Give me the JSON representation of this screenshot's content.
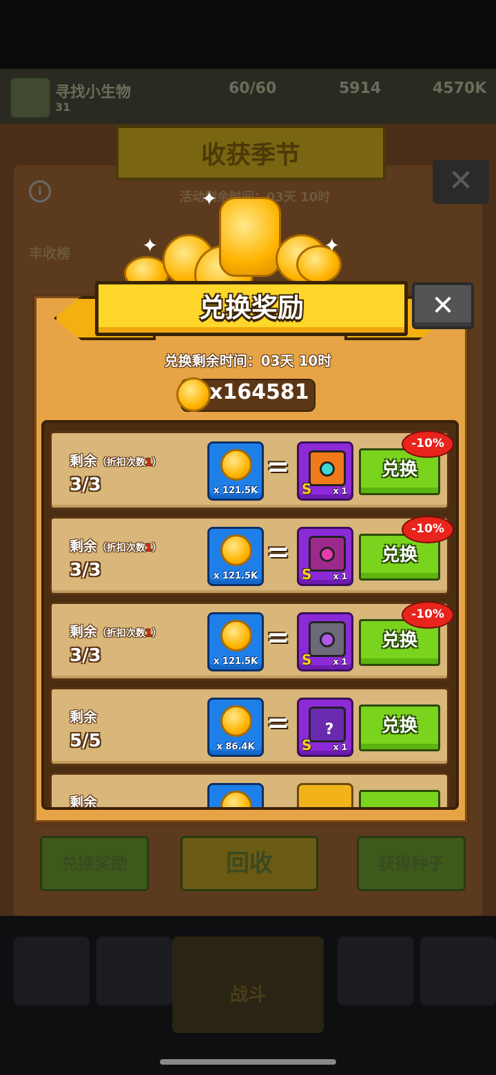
{
  "background": {
    "status_name": "寻找小生物",
    "status_level": "31",
    "energy": "60/60",
    "currency_1": "5914",
    "currency_2": "4570K",
    "season_title": "收获季节",
    "timer_text": "活动剩余时间：03天 10时",
    "rank_label": "丰收榜",
    "buttons": [
      "兑换奖励",
      "回收",
      "获得种子"
    ],
    "nav_center": "战斗"
  },
  "dialog": {
    "title": "兑换奖励",
    "close_label": "✕",
    "timer": "兑换剩余时间：03天 10时",
    "balance": "x164581"
  },
  "rows": [
    {
      "label": "剩余",
      "sub": "（折扣次数",
      "sub_count": "1",
      "sub_end": "）",
      "count": "3/3",
      "cost": "x 121.5K",
      "reward_grade": "S",
      "reward_qty": "x 1",
      "button": "兑换",
      "badge": "-10%"
    },
    {
      "label": "剩余",
      "sub": "（折扣次数",
      "sub_count": "1",
      "sub_end": "）",
      "count": "3/3",
      "cost": "x 121.5K",
      "reward_grade": "S",
      "reward_qty": "x 1",
      "button": "兑换",
      "badge": "-10%"
    },
    {
      "label": "剩余",
      "sub": "（折扣次数",
      "sub_count": "1",
      "sub_end": "）",
      "count": "3/3",
      "cost": "x 121.5K",
      "reward_grade": "S",
      "reward_qty": "x 1",
      "button": "兑换",
      "badge": "-10%"
    },
    {
      "label": "剩余",
      "count": "5/5",
      "cost": "x 86.4K",
      "reward_grade": "S",
      "reward_qty": "x 1",
      "reward_symbol": "?",
      "button": "兑换"
    },
    {
      "label": "剩余"
    }
  ],
  "equals": "=",
  "colors": {
    "accent_green": "#7ad41e",
    "discount_red": "#e8241c",
    "panel": "#e6a446"
  }
}
